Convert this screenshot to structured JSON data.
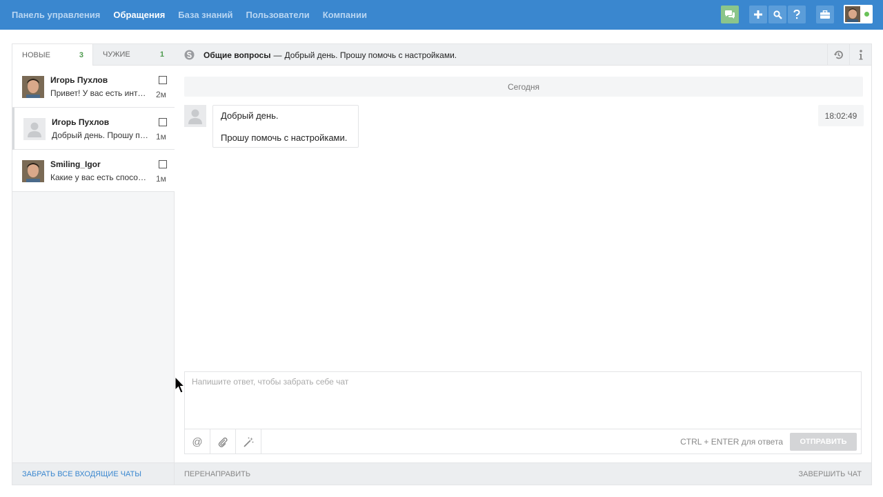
{
  "nav": {
    "items": [
      "Панель управления",
      "Обращения",
      "База знаний",
      "Пользователи",
      "Компании"
    ],
    "active_index": 1
  },
  "toolbar": {
    "icons": [
      "chat-icon",
      "plus-icon",
      "search-icon",
      "help-icon",
      "briefcase-icon"
    ],
    "status_color": "#6ac259"
  },
  "tabs": [
    {
      "label": "НОВЫЕ",
      "count": "3"
    },
    {
      "label": "ЧУЖИЕ",
      "count": "1"
    }
  ],
  "chats": [
    {
      "name": "Игорь Пухлов",
      "message": "Привет! У вас есть интеграция?",
      "age": "2м",
      "has_photo": true
    },
    {
      "name": "Игорь Пухлов",
      "message": "Добрый день. Прошу помочь с настройками.",
      "age": "1м",
      "has_photo": false,
      "selected": true
    },
    {
      "name": "Smiling_Igor",
      "message": "Какие у вас есть способы оплаты?",
      "age": "1м",
      "has_photo": true
    }
  ],
  "left_footer": "ЗАБРАТЬ ВСЕ ВХОДЯЩИЕ ЧАТЫ",
  "conversation": {
    "subject": "Общие вопросы",
    "dash": "—",
    "summary": "Добрый день. Прошу помочь с настройками.",
    "day_separator": "Сегодня",
    "messages": [
      {
        "lines": [
          "Добрый день.",
          "Прошу помочь с настройками."
        ],
        "time": "18:02:49"
      }
    ]
  },
  "composer": {
    "placeholder": "Напишите ответ, чтобы забрать себе чат",
    "hint": "CTRL + ENTER для ответа",
    "send_label": "ОТПРАВИТЬ",
    "tools": [
      "@"
    ]
  },
  "right_footer": {
    "redirect": "ПЕРЕНАПРАВИТЬ",
    "finish": "ЗАВЕРШИТЬ ЧАТ"
  },
  "colors": {
    "topbar": "#3a87cf",
    "accent_green": "#4e9a4e",
    "link_blue": "#3a87cf"
  }
}
